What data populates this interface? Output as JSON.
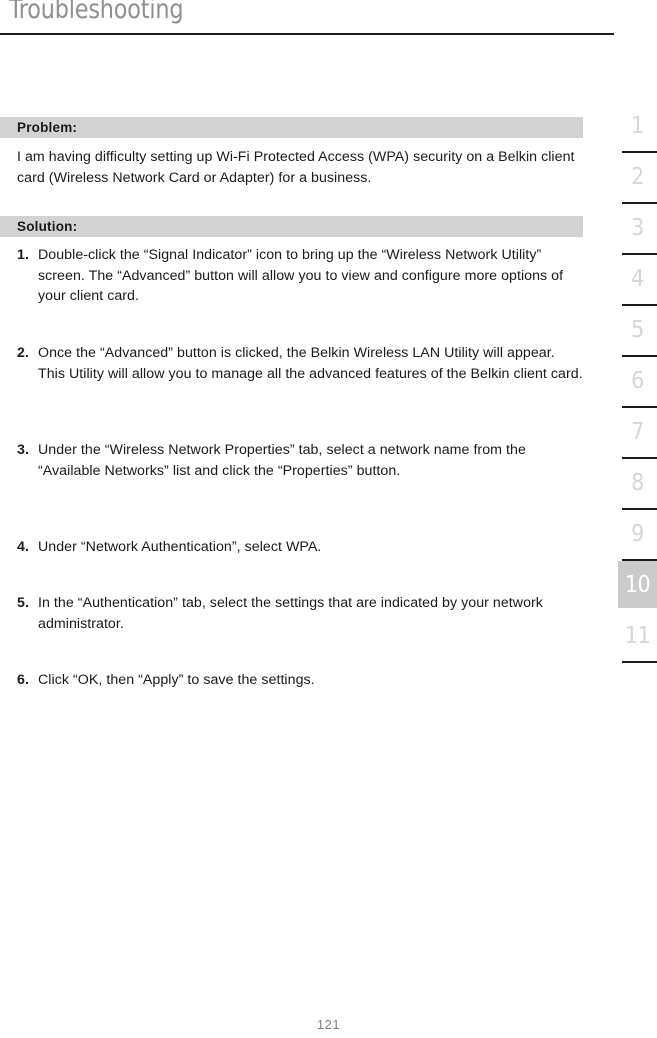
{
  "header": {
    "title": "Troubleshooting"
  },
  "problem": {
    "label": "Problem:",
    "body": "I am having difficulty setting up Wi-Fi Protected Access (WPA) security on a Belkin client card (Wireless Network Card or Adapter) for a business."
  },
  "solution": {
    "label": "Solution:",
    "steps": [
      {
        "number": "1.",
        "text": "Double-click the “Signal Indicator” icon to bring up the “Wireless Network Utility” screen. The “Advanced” button will allow you to view and configure more options of your client card."
      },
      {
        "number": "2.",
        "text": "Once the “Advanced” button is clicked, the Belkin Wireless LAN Utility will appear. This Utility will allow you to manage all the advanced features of the Belkin client card."
      },
      {
        "number": "3.",
        "text": "Under the “Wireless Network Properties” tab, select a network name from the “Available Networks” list and click the “Properties” button."
      },
      {
        "number": "4.",
        "text": "Under “Network Authentication”, select WPA."
      },
      {
        "number": "5.",
        "text": "In the “Authentication” tab, select the settings that are indicated by your network administrator."
      },
      {
        "number": "6.",
        "text": "Click “OK, then “Apply” to save the settings."
      }
    ]
  },
  "sidebar": {
    "active_index": 9,
    "items": [
      {
        "label": "1"
      },
      {
        "label": "2"
      },
      {
        "label": "3"
      },
      {
        "label": "4"
      },
      {
        "label": "5"
      },
      {
        "label": "6"
      },
      {
        "label": "7"
      },
      {
        "label": "8"
      },
      {
        "label": "9"
      },
      {
        "label": "10"
      },
      {
        "label": "11"
      }
    ]
  },
  "footer": {
    "page_number": "121"
  },
  "colors": {
    "section_bar": "#d2d2d2",
    "sidebar_number": "#d6d6d6",
    "sidebar_active_bg": "#cbcbcb",
    "rule": "#1c1c1c",
    "title": "#8e9093"
  }
}
